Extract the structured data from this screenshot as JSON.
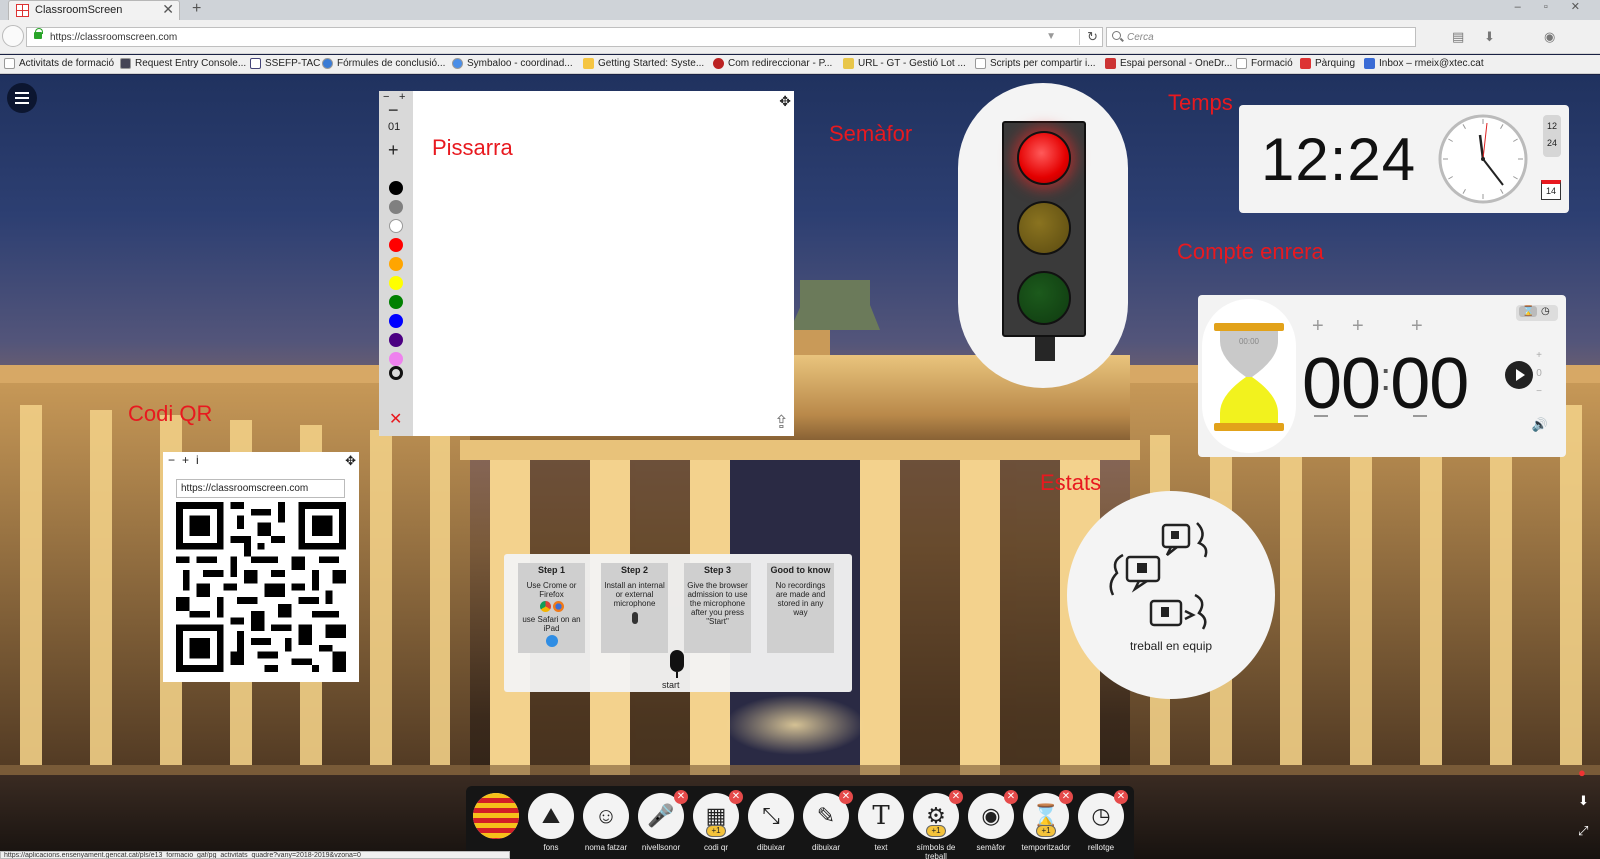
{
  "browser": {
    "tab_title": "ClassroomScreen",
    "tab_close": "✕",
    "new_tab": "+",
    "window_controls": "– ▫ ✕",
    "url": "https://classroomscreen.com",
    "url_dropdown": "▼",
    "reload": "↻",
    "search_placeholder": "Cerca",
    "bookmarks": [
      "Activitats de formació",
      "Request Entry Console...",
      "SSEFP-TAC",
      "Fórmules de conclusió...",
      "Symbaloo - coordinad...",
      "Getting Started: Syste...",
      "Com redireccionar - P...",
      "URL - GT - Gestió Lot ...",
      "Scripts per compartir i...",
      "Espai personal - OneDr...",
      "Formació",
      "Pàrquing",
      "Inbox – rmeix@xtec.cat"
    ],
    "status_url": "https://aplicacions.ensenyament.gencat.cat/pls/e13_formacio_gaf/pg_activitats_quadre?vany=2018-2019&vzona=0"
  },
  "labels": {
    "whiteboard": "Pissarra",
    "traffic_light": "Semàfor",
    "time": "Temps",
    "countdown": "Compte enrera",
    "qr": "Codi QR",
    "states": "Estats"
  },
  "whiteboard": {
    "minus": "−",
    "plus_small": "+",
    "decrease": "−",
    "pen_size": "01",
    "increase": "+",
    "close": "✕",
    "move": "✥",
    "upload": "⇪",
    "colors": [
      "#000000",
      "#808080",
      "#ffffff",
      "#ff0000",
      "#ffa500",
      "#ffff00",
      "#008000",
      "#0000ff",
      "#4b0082",
      "#ee82ee"
    ]
  },
  "clock": {
    "time": "12:24",
    "format_12": "12",
    "format_24": "24",
    "date_day": "14"
  },
  "timer": {
    "display_min": "00",
    "separator": ":",
    "display_sec": "00",
    "hourglass_text": "00:00",
    "plus": "+",
    "side_plus": "+",
    "side_value": "0",
    "side_minus": "−",
    "mode_hourglass": "⌛",
    "mode_clock": "◷",
    "speaker": "🔊"
  },
  "work_symbol": {
    "label": "treball en equip"
  },
  "qr": {
    "minus": "−",
    "plus": "+",
    "info": "i",
    "move": "✥",
    "url": "https://classroomscreen.com"
  },
  "sound_level": {
    "steps": [
      {
        "title": "Step 1",
        "text": "Use Crome or Firefox",
        "text2": "use Safari on an iPad"
      },
      {
        "title": "Step 2",
        "text": "Install an internal or external microphone",
        "text2": ""
      },
      {
        "title": "Step 3",
        "text": "Give the browser admission to use the microphone after you press \"Start\"",
        "text2": ""
      },
      {
        "title": "Good to know",
        "text": "No recordings are made and stored in any way",
        "text2": ""
      }
    ],
    "start": "start"
  },
  "dock": {
    "tools": [
      {
        "label": "",
        "icon": "catalan-flag-icon",
        "badge": false,
        "plus1": false
      },
      {
        "label": "fons",
        "icon": "background-icon",
        "badge": false,
        "plus1": false
      },
      {
        "label": "noma fatzar",
        "icon": "random-name-icon",
        "badge": false,
        "plus1": false
      },
      {
        "label": "nivellsonor",
        "icon": "microphone-icon",
        "badge": true,
        "plus1": false
      },
      {
        "label": "codi qr",
        "icon": "qr-icon",
        "badge": true,
        "plus1": true
      },
      {
        "label": "dibuixar",
        "icon": "draw-fullscreen-icon",
        "badge": false,
        "plus1": false
      },
      {
        "label": "dibuixar",
        "icon": "draw-icon",
        "badge": true,
        "plus1": false
      },
      {
        "label": "text",
        "icon": "text-icon",
        "badge": false,
        "plus1": false
      },
      {
        "label": "símbols de treball",
        "icon": "work-symbols-icon",
        "badge": true,
        "plus1": true
      },
      {
        "label": "semàfor",
        "icon": "traffic-light-icon",
        "badge": true,
        "plus1": false
      },
      {
        "label": "temporitzador",
        "icon": "hourglass-icon",
        "badge": true,
        "plus1": true
      },
      {
        "label": "rellotge",
        "icon": "clock-icon",
        "badge": true,
        "plus1": false
      }
    ],
    "badge_glyph": "✕",
    "plus1_glyph": "+1",
    "text_glyph": "T"
  }
}
